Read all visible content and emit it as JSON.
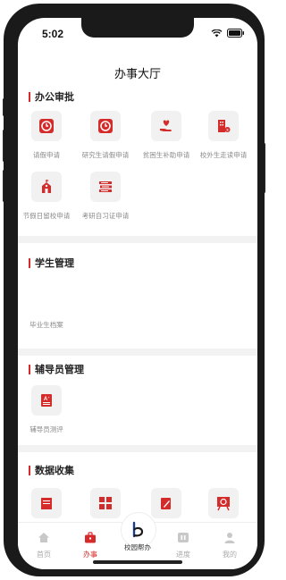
{
  "status": {
    "time": "5:02"
  },
  "header": {
    "title": "办事大厅"
  },
  "sections": {
    "office": {
      "title": "办公审批",
      "items": [
        {
          "label": "请假申请",
          "icon": "clock-icon"
        },
        {
          "label": "研究生请假申请",
          "icon": "clock-icon"
        },
        {
          "label": "贫困生补助申请",
          "icon": "heart-hand-icon"
        },
        {
          "label": "校外生走读申请",
          "icon": "building-icon"
        },
        {
          "label": "节假日留校申请",
          "icon": "school-icon"
        },
        {
          "label": "考研自习证申请",
          "icon": "books-icon"
        }
      ]
    },
    "student": {
      "title": "学生管理",
      "items": [
        {
          "label": "毕业生档案"
        }
      ]
    },
    "counselor": {
      "title": "辅导员管理",
      "items": [
        {
          "label": "辅导员测评",
          "icon": "grade-icon"
        }
      ]
    },
    "data": {
      "title": "数据收集",
      "items": [
        {
          "icon": "form-icon"
        },
        {
          "icon": "grid-icon"
        },
        {
          "icon": "pencil-icon"
        },
        {
          "icon": "board-clock-icon"
        }
      ]
    }
  },
  "tabbar": {
    "tabs": [
      {
        "label": "首页",
        "icon": "home-icon"
      },
      {
        "label": "办事",
        "icon": "briefcase-icon"
      },
      {
        "label": "进度",
        "icon": "progress-icon"
      },
      {
        "label": "我的",
        "icon": "user-icon"
      }
    ],
    "center": {
      "label": "校园帮办",
      "logo": "b"
    }
  },
  "colors": {
    "accent": "#d42b2b",
    "tile_bg": "#f1f1f1",
    "muted_text": "#8a8a8a"
  }
}
